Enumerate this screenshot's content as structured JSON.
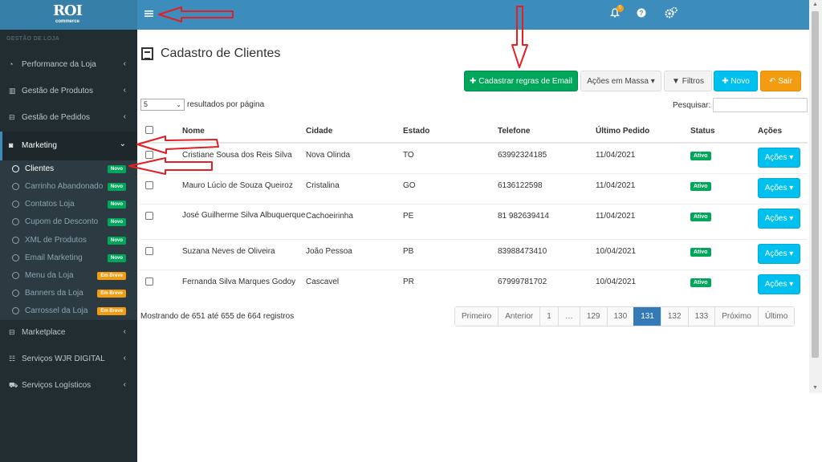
{
  "logo": {
    "main": "ROI",
    "sub": "commerce"
  },
  "topbar": {
    "menu_icon": "bars-icon",
    "notification_count": "0"
  },
  "sidebar": {
    "section_header": "GESTÃO DE LOJA",
    "items": [
      {
        "label": "Performance da Loja",
        "icon": "dashboard-icon"
      },
      {
        "label": "Gestão de Produtos",
        "icon": "barcode-icon"
      },
      {
        "label": "Gestão de Pedidos",
        "icon": "inbox-icon"
      },
      {
        "label": "Marketing",
        "icon": "bullhorn-icon"
      },
      {
        "label": "Marketplace",
        "icon": "inbox-icon"
      },
      {
        "label": "Serviços WJR DIGITAL",
        "icon": "sitemap-icon"
      },
      {
        "label": "Serviços Logísticos",
        "icon": "truck-icon"
      }
    ],
    "submenu": [
      {
        "label": "Clientes",
        "badge": "Novo",
        "badge_color": "#00a65a"
      },
      {
        "label": "Carrinho Abandonado",
        "badge": "Novo",
        "badge_color": "#00a65a"
      },
      {
        "label": "Contatos Loja",
        "badge": "Novo",
        "badge_color": "#00a65a"
      },
      {
        "label": "Cupom de Desconto",
        "badge": "Novo",
        "badge_color": "#00a65a"
      },
      {
        "label": "XML de Produtos",
        "badge": "Novo",
        "badge_color": "#00a65a"
      },
      {
        "label": "Email Marketing",
        "badge": "Novo",
        "badge_color": "#00a65a"
      },
      {
        "label": "Menu da Loja",
        "badge": "Em Breve",
        "badge_color": "#f39c12"
      },
      {
        "label": "Banners da Loja",
        "badge": "Em Breve",
        "badge_color": "#f39c12"
      },
      {
        "label": "Carrossel da Loja",
        "badge": "Em Breve",
        "badge_color": "#f39c12"
      }
    ]
  },
  "page": {
    "title": "Cadastro de Clientes"
  },
  "toolbar": {
    "email_rules": "Cadastrar regras de Email",
    "bulk_actions": "Ações em Massa",
    "filters": "Filtros",
    "new": "Novo",
    "exit": "Sair"
  },
  "list_controls": {
    "page_length": "5",
    "page_length_label": "resultados por página",
    "search_label": "Pesquisar:",
    "search_value": ""
  },
  "table": {
    "headers": [
      "Nome",
      "Cidade",
      "Estado",
      "Telefone",
      "Último Pedido",
      "Status",
      "Ações"
    ],
    "rows": [
      {
        "nome": "Cristiane Sousa dos Reis Silva",
        "cidade": "Nova Olinda",
        "estado": "TO",
        "telefone": "63992324185",
        "ultimo_pedido": "11/04/2021",
        "status": "Ativo",
        "acoes": "Ações"
      },
      {
        "nome": "Mauro Lúcio de Souza Queiroz",
        "cidade": "Cristalina",
        "estado": "GO",
        "telefone": "6136122598",
        "ultimo_pedido": "11/04/2021",
        "status": "Ativo",
        "acoes": "Ações"
      },
      {
        "nome": "José Guilherme Silva Albuquerque",
        "cidade": "Cachoeirinha",
        "estado": "PE",
        "telefone": "81 982639414",
        "ultimo_pedido": "11/04/2021",
        "status": "Ativo",
        "acoes": "Ações"
      },
      {
        "nome": "Suzana Neves de Oliveira",
        "cidade": "João Pessoa",
        "estado": "PB",
        "telefone": "83988473410",
        "ultimo_pedido": "10/04/2021",
        "status": "Ativo",
        "acoes": "Ações"
      },
      {
        "nome": "Fernanda Silva Marques Godoy",
        "cidade": "Cascavel",
        "estado": "PR",
        "telefone": "67999781702",
        "ultimo_pedido": "10/04/2021",
        "status": "Ativo",
        "acoes": "Ações"
      }
    ]
  },
  "footer": {
    "info": "Mostrando de 651 até 655 de 664 registros",
    "pagination": [
      "Primeiro",
      "Anterior",
      "1",
      "…",
      "129",
      "130",
      "131",
      "132",
      "133",
      "Próximo",
      "Último"
    ],
    "current_page": "131"
  },
  "colors": {
    "topbar": "#3c8dbc",
    "sidebar": "#222d32",
    "annotation_arrow": "#e31e24"
  }
}
